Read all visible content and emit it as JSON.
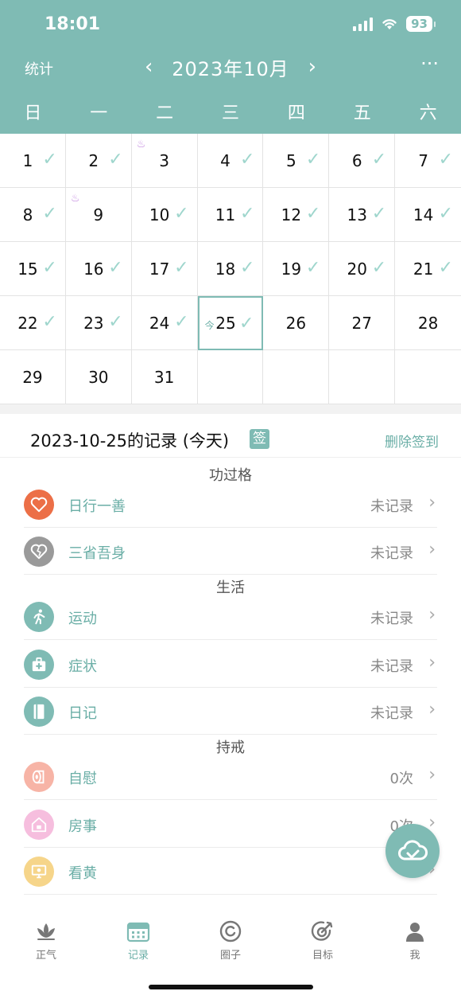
{
  "status_bar": {
    "time": "18:01",
    "battery": "93"
  },
  "header": {
    "stat_label": "统计",
    "month_title": "2023年10月",
    "prev": "‹",
    "next": "›",
    "more": "···"
  },
  "weekdays": [
    "日",
    "一",
    "二",
    "三",
    "四",
    "五",
    "六"
  ],
  "calendar": {
    "rows": [
      [
        "1",
        "2",
        "3",
        "4",
        "5",
        "6",
        "7"
      ],
      [
        "8",
        "9",
        "10",
        "11",
        "12",
        "13",
        "14"
      ],
      [
        "15",
        "16",
        "17",
        "18",
        "19",
        "20",
        "21"
      ],
      [
        "22",
        "23",
        "24",
        "25",
        "26",
        "27",
        "28"
      ],
      [
        "29",
        "30",
        "31",
        "",
        "",
        "",
        ""
      ]
    ],
    "today_tag": "今",
    "check_glyph": "✓",
    "flag_glyph": "♨"
  },
  "record": {
    "title": "2023-10-25的记录 (今天)",
    "sign_badge": "签",
    "delete_label": "删除签到"
  },
  "sections": {
    "merit": "功过格",
    "life": "生活",
    "precepts": "持戒"
  },
  "items": {
    "good_deed": {
      "label": "日行一善",
      "value": "未记录"
    },
    "reflect": {
      "label": "三省吾身",
      "value": "未记录"
    },
    "exercise": {
      "label": "运动",
      "value": "未记录"
    },
    "symptom": {
      "label": "症状",
      "value": "未记录"
    },
    "diary": {
      "label": "日记",
      "value": "未记录"
    },
    "masturbation": {
      "label": "自慰",
      "value": "0次"
    },
    "intercourse": {
      "label": "房事",
      "value": "0次"
    },
    "porn": {
      "label": "看黄",
      "value": ""
    }
  },
  "chevron": "›",
  "tabbar": {
    "zhengqi": "正气",
    "record": "记录",
    "circle": "圈子",
    "goal": "目标",
    "me": "我"
  },
  "colors": {
    "accent": "#7fbbb4",
    "accent_text": "#6aaea6",
    "check": "#9fd6cd"
  }
}
